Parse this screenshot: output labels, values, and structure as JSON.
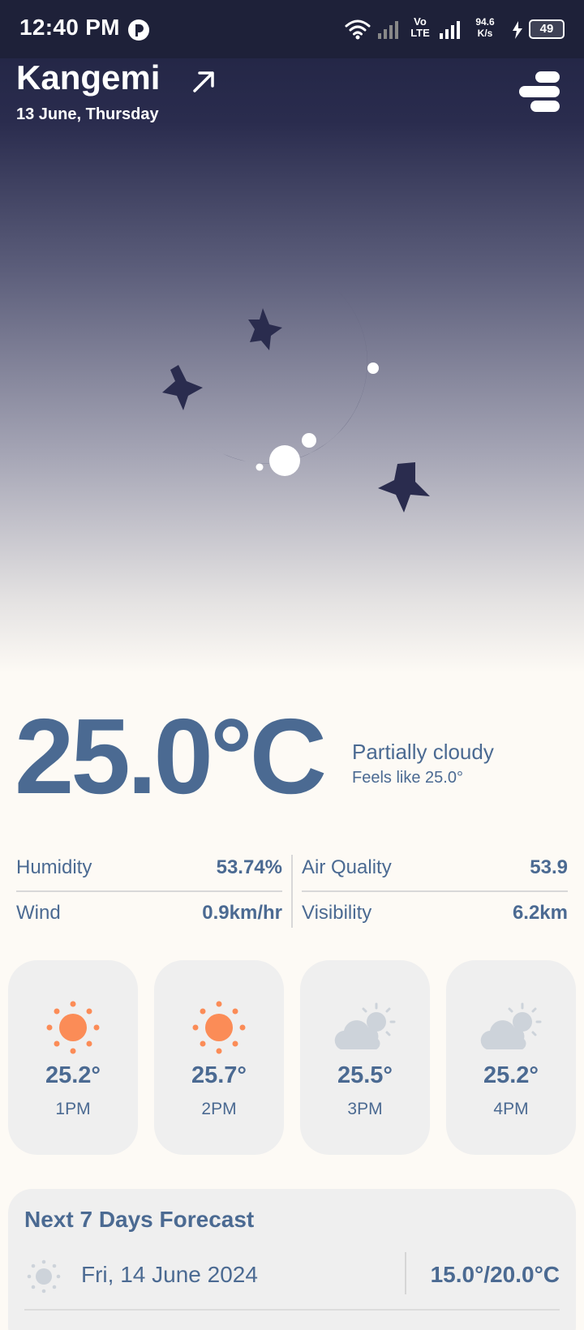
{
  "status_bar": {
    "time": "12:40 PM",
    "volte_line1": "Vo",
    "volte_line2": "LTE",
    "speed_line1": "94.6",
    "speed_line2": "K/s",
    "battery": "49"
  },
  "header": {
    "city": "Kangemi",
    "date": "13 June, Thursday"
  },
  "current": {
    "temperature": "25.0°C",
    "condition": "Partially cloudy",
    "feels_like": "Feels like 25.0°"
  },
  "metrics": {
    "humidity_label": "Humidity",
    "humidity_value": "53.74%",
    "air_quality_label": "Air Quality",
    "air_quality_value": "53.9",
    "wind_label": "Wind",
    "wind_value": "0.9km/hr",
    "visibility_label": "Visibility",
    "visibility_value": "6.2km"
  },
  "hourly": [
    {
      "temp": "25.2°",
      "time": "1PM",
      "icon": "sun-icon"
    },
    {
      "temp": "25.7°",
      "time": "2PM",
      "icon": "sun-icon"
    },
    {
      "temp": "25.5°",
      "time": "3PM",
      "icon": "partly-cloudy-icon"
    },
    {
      "temp": "25.2°",
      "time": "4PM",
      "icon": "partly-cloudy-icon"
    }
  ],
  "forecast": {
    "title": "Next 7 Days Forecast",
    "days": [
      {
        "date": "Fri, 14 June 2024",
        "temps": "15.0°/20.0°C",
        "icon": "sun-icon"
      }
    ]
  },
  "colors": {
    "accent": "#4b6a92",
    "sun": "#fb8c57",
    "moon": "#2a2c4e",
    "card": "#efefef",
    "background": "#fdfaf5"
  }
}
